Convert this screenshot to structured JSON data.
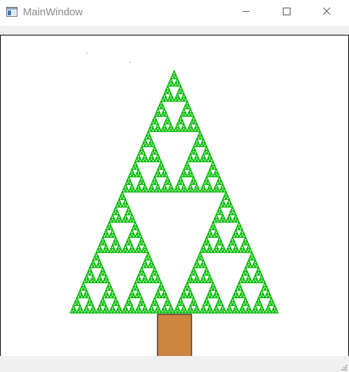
{
  "window": {
    "title": "MainWindow",
    "icon": "app-window-icon",
    "controls": {
      "minimize_icon": "minimize-icon",
      "maximize_icon": "maximize-icon",
      "close_icon": "close-icon"
    }
  },
  "toolbar": {
    "grip_icon": "toolbar-grip-icon"
  },
  "canvas": {
    "fractal": "sierpinski-triangle",
    "depth": 6,
    "tree_color": "#00bb00",
    "trunk_color": "#cd853f",
    "trunk_border": "#000000",
    "background": "#ffffff"
  },
  "statusbar": {
    "grip_icon": "size-grip-icon"
  }
}
